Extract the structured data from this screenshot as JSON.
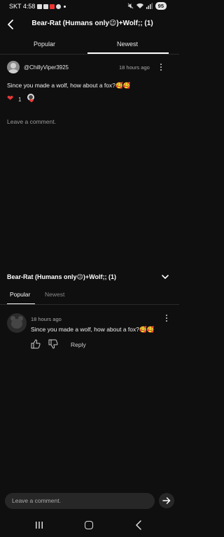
{
  "status_bar": {
    "carrier_time": "SKT 4:58",
    "battery": "95"
  },
  "header": {
    "title": "Bear-Rat (Humans only😉)+Wolf;; (1)",
    "tabs": [
      {
        "label": "Popular",
        "active": false
      },
      {
        "label": "Newest",
        "active": true
      }
    ]
  },
  "comment_top": {
    "author": "@ChillyViper3925",
    "time": "18 hours ago",
    "text": "Since you made a wolf, how about a fox?🥰🥰",
    "like_count": "1"
  },
  "leave_comment_top": "Leave a comment.",
  "sheet": {
    "title": "Bear-Rat (Humans only😉)+Wolf;; (1)",
    "tabs": [
      {
        "label": "Popular",
        "active": true
      },
      {
        "label": "Newest",
        "active": false
      }
    ]
  },
  "comment_bottom": {
    "time": "18 hours ago",
    "text": "Since you made a wolf, how about a fox?🥰🥰",
    "reply_label": "Reply"
  },
  "input": {
    "placeholder": "Leave a comment."
  },
  "colors": {
    "background": "#0f0f0f",
    "heart": "#e53935",
    "accent_text": "#f1f1f1"
  }
}
